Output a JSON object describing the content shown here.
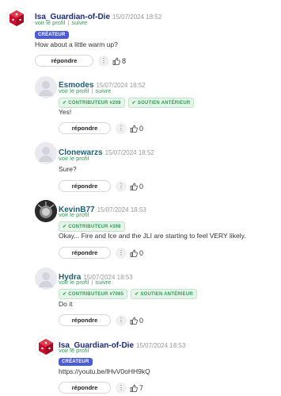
{
  "labels": {
    "view_profile": "voir le profil",
    "separator": "|",
    "follow": "suivre",
    "reply": "répondre",
    "more": "⋮"
  },
  "colors": {
    "creator_badge": "#4b5bd6",
    "link_green": "#2f9e55",
    "name_blue": "#1d2a7a"
  },
  "comments": [
    {
      "author": "Isa_Guardian-of-Die",
      "date": "15/07/2024 18:52",
      "badges": [
        "CRÉATEUR"
      ],
      "text": "How about a little warm up?",
      "likes": "8",
      "avatar": "red-die-avatar"
    },
    {
      "author": "Esmodes",
      "date": "15/07/2024 18:52",
      "badges": [
        "CONTRIBUTEUR #208",
        "SOUTIEN ANTÉRIEUR"
      ],
      "text": "Yes!",
      "likes": "0",
      "avatar": "default-avatar"
    },
    {
      "author": "Clonewarzs",
      "date": "15/07/2024 18:52",
      "badges": [],
      "text": "Sure?",
      "likes": "0",
      "avatar": "default-avatar"
    },
    {
      "author": "KevinB77",
      "date": "15/07/2024 18:53",
      "badges": [
        "CONTRIBUTEUR #398"
      ],
      "text": "Okay... Fire and Ice and the JLI are starting to feel VERY likely.",
      "likes": "0",
      "avatar": "photo-avatar"
    },
    {
      "author": "Hydra",
      "date": "15/07/2024 18:53",
      "badges": [
        "CONTRIBUTEUR #7065",
        "SOUTIEN ANTÉRIEUR"
      ],
      "text": "Do it",
      "likes": "0",
      "avatar": "default-avatar"
    },
    {
      "author": "Isa_Guardian-of-Die",
      "date": "15/07/2024 18:53",
      "badges": [
        "CRÉATEUR"
      ],
      "text": "https://youtu.be/lHvV0oHH9kQ",
      "likes": "7",
      "avatar": "red-die-avatar"
    }
  ]
}
